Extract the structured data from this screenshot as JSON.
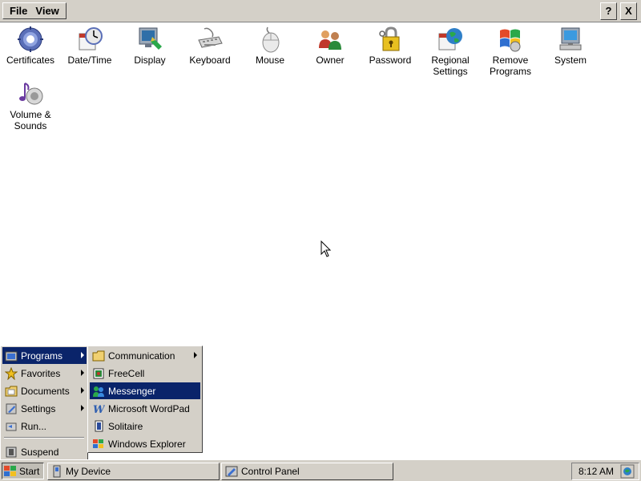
{
  "menubar": {
    "menus": [
      {
        "label": "File"
      },
      {
        "label": "View"
      }
    ],
    "help_label": "?",
    "close_label": "X"
  },
  "icons": [
    {
      "label": "Certificates",
      "icon": "certificates-icon"
    },
    {
      "label": "Date/Time",
      "icon": "date-time-icon"
    },
    {
      "label": "Display",
      "icon": "display-icon"
    },
    {
      "label": "Keyboard",
      "icon": "keyboard-icon"
    },
    {
      "label": "Mouse",
      "icon": "mouse-icon"
    },
    {
      "label": "Owner",
      "icon": "owner-icon"
    },
    {
      "label": "Password",
      "icon": "password-icon"
    },
    {
      "label_line1": "Regional",
      "label_line2": "Settings",
      "icon": "regional-settings-icon"
    },
    {
      "label_line1": "Remove",
      "label_line2": "Programs",
      "icon": "remove-programs-icon"
    },
    {
      "label": "System",
      "icon": "system-icon"
    },
    {
      "label_line1": "Volume &",
      "label_line2": "Sounds",
      "icon": "volume-sounds-icon"
    }
  ],
  "start_menu": {
    "items": [
      {
        "label": "Programs",
        "has_submenu": true,
        "selected": true,
        "icon": "programs-folder-icon"
      },
      {
        "label": "Favorites",
        "has_submenu": true,
        "icon": "favorites-star-icon"
      },
      {
        "label": "Documents",
        "has_submenu": true,
        "icon": "documents-folder-icon"
      },
      {
        "label": "Settings",
        "has_submenu": true,
        "icon": "settings-icon"
      },
      {
        "label": "Run...",
        "icon": "run-icon"
      },
      {
        "label": "Suspend",
        "icon": "suspend-icon"
      }
    ]
  },
  "programs_submenu": {
    "items": [
      {
        "label": "Communication",
        "has_submenu": true,
        "icon": "folder-icon"
      },
      {
        "label": "FreeCell",
        "icon": "freecell-icon"
      },
      {
        "label": "Messenger",
        "selected": true,
        "icon": "messenger-icon"
      },
      {
        "label": "Microsoft WordPad",
        "icon": "wordpad-icon"
      },
      {
        "label": "Solitaire",
        "icon": "solitaire-icon"
      },
      {
        "label": "Windows Explorer",
        "icon": "windows-explorer-icon"
      }
    ]
  },
  "taskbar": {
    "start_label": "Start",
    "tasks": [
      {
        "label": "My Device",
        "icon": "my-device-icon"
      },
      {
        "label": "Control Panel",
        "icon": "control-panel-icon",
        "active": true
      }
    ],
    "clock": "8:12 AM"
  },
  "colors": {
    "chrome": "#d4d0c8",
    "highlight": "#0a246a",
    "desktop": "#ffffff"
  }
}
